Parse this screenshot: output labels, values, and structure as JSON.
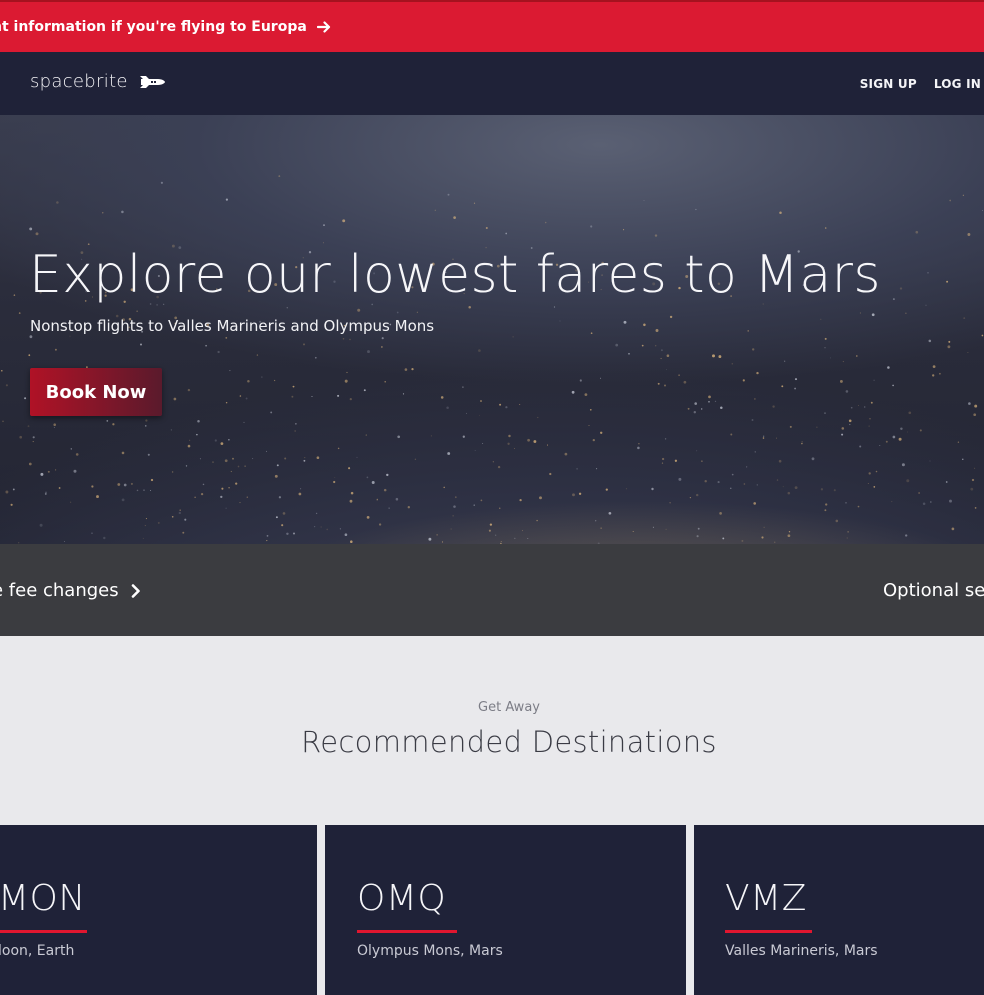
{
  "alert": {
    "text": "nt information if you're flying to Europa"
  },
  "nav": {
    "brand": "spacebrite",
    "links": [
      "SIGN UP",
      "LOG IN"
    ]
  },
  "hero": {
    "title": "Explore our lowest fares to Mars",
    "subtitle": "Nonstop flights to Valles Marineris and Olympus Mons",
    "cta": "Book Now"
  },
  "info": {
    "left": "e fee changes",
    "right": "Optional se"
  },
  "destinations": {
    "label": "Get Away",
    "title": "Recommended Destinations",
    "cards": [
      {
        "code": "MON",
        "city": "loon, Earth"
      },
      {
        "code": "OMQ",
        "city": "Olympus Mons, Mars"
      },
      {
        "code": "VMZ",
        "city": "Valles Marineris, Mars"
      }
    ]
  },
  "colors": {
    "accent": "#db1a32",
    "navy": "#1f2238",
    "band": "#3b3c40",
    "background": "#e9e9ec"
  }
}
